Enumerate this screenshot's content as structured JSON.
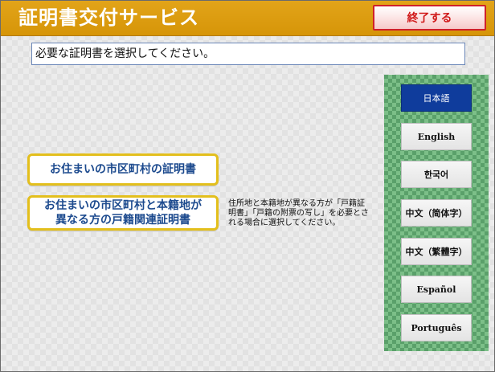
{
  "header": {
    "title": "証明書交付サービス",
    "end_button": "終了する"
  },
  "instruction": "必要な証明書を選択してください。",
  "certificates": [
    {
      "label": "お住まいの市区町村の証明書"
    },
    {
      "label_line1": "お住まいの市区町村と本籍地が",
      "label_line2": "異なる方の戸籍関連証明書"
    }
  ],
  "note": "住所地と本籍地が異なる方が「戸籍証明書」「戸籍の附票の写し」を必要とされる場合に選択してください。",
  "languages": [
    {
      "label": "日本語",
      "active": true
    },
    {
      "label": "English"
    },
    {
      "label": "한국어"
    },
    {
      "label": "中文（简体字）"
    },
    {
      "label": "中文（繁體字）"
    },
    {
      "label": "Español"
    },
    {
      "label": "Português"
    }
  ],
  "colors": {
    "header": "#d69508",
    "end_button_border": "#d0202a",
    "cert_border": "#e3bf1c",
    "cert_text": "#1c4a8e",
    "lang_panel": "#5aa06a",
    "lang_active": "#0f3c9c"
  }
}
